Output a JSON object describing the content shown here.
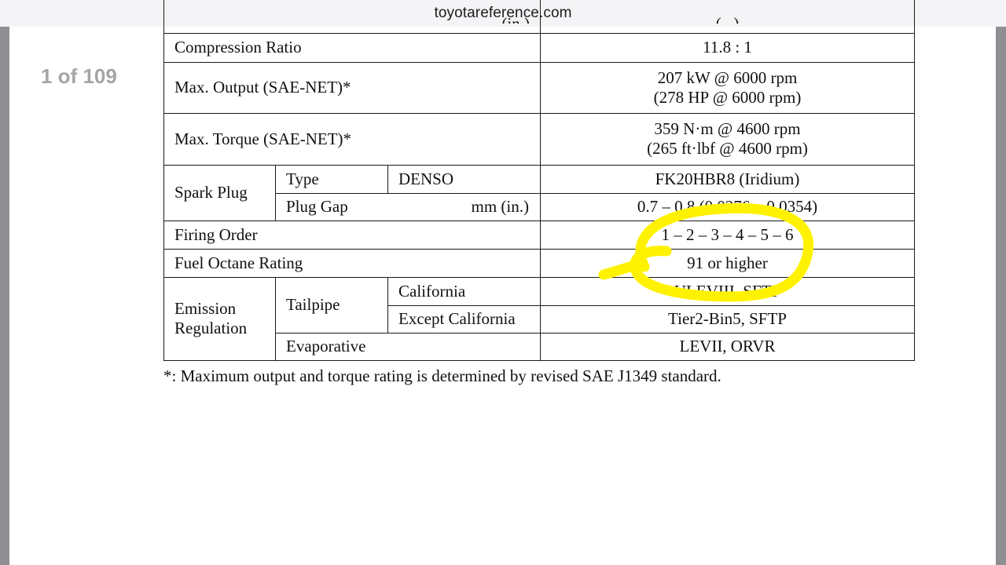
{
  "browser": {
    "domain": "toyotareference.com"
  },
  "viewer": {
    "page_indicator": "1 of 109"
  },
  "spec_table": {
    "top_partial": {
      "left": "(in.)",
      "right": "(...)"
    },
    "compression_ratio": {
      "label": "Compression Ratio",
      "value": "11.8 : 1"
    },
    "max_output": {
      "label": "Max. Output (SAE-NET)*",
      "value_line1": "207 kW @ 6000 rpm",
      "value_line2": "(278 HP @ 6000 rpm)"
    },
    "max_torque": {
      "label": "Max. Torque (SAE-NET)*",
      "value_line1": "359 N·m @ 4600 rpm",
      "value_line2": "(265 ft·lbf @ 4600 rpm)"
    },
    "spark_plug": {
      "label": "Spark Plug",
      "type_label": "Type",
      "brand": "DENSO",
      "type_value": "FK20HBR8 (Iridium)",
      "gap_label": "Plug Gap",
      "gap_unit": "mm (in.)",
      "gap_value": "0.7 – 0.8 (0.0276 – 0.0354)"
    },
    "firing_order": {
      "label": "Firing Order",
      "value": "1 – 2 – 3 – 4 – 5 – 6"
    },
    "fuel_octane": {
      "label": "Fuel Octane Rating",
      "value": "91 or higher"
    },
    "emission": {
      "label_line1": "Emission",
      "label_line2": "Regulation",
      "tailpipe_label": "Tailpipe",
      "california_label": "California",
      "california_value": "ULEVIII, SFTP",
      "except_label": "Except California",
      "except_value": "Tier2-Bin5, SFTP",
      "evaporative_label": "Evaporative",
      "evaporative_value": "LEVII, ORVR"
    }
  },
  "footnote": "*: Maximum output and torque rating is determined by revised SAE J1349 standard.",
  "annotation": {
    "color": "#fff200"
  }
}
